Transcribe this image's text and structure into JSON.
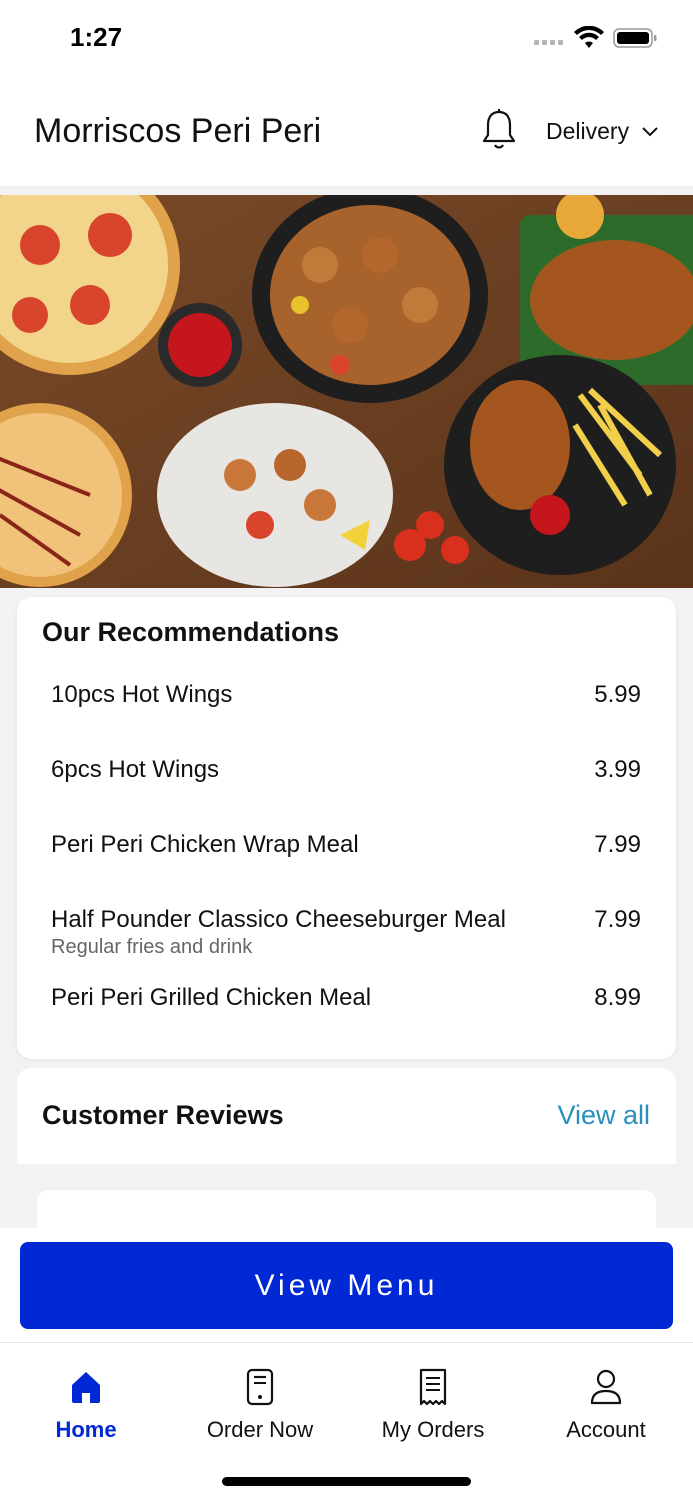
{
  "status_bar": {
    "time": "1:27"
  },
  "header": {
    "title": "Morriscos Peri Peri",
    "order_mode": "Delivery"
  },
  "recommendations": {
    "title": "Our Recommendations",
    "items": [
      {
        "name": "10pcs Hot Wings",
        "description": "",
        "price": "5.99"
      },
      {
        "name": "6pcs Hot Wings",
        "description": "",
        "price": "3.99"
      },
      {
        "name": "Peri Peri Chicken Wrap Meal",
        "description": "",
        "price": "7.99"
      },
      {
        "name": "Half Pounder Classico Cheeseburger Meal",
        "description": "Regular fries and drink",
        "price": "7.99"
      },
      {
        "name": "Peri Peri Grilled Chicken Meal",
        "description": "",
        "price": "8.99"
      }
    ]
  },
  "reviews": {
    "title": "Customer Reviews",
    "view_all": "View all"
  },
  "cta": {
    "label": "View Menu"
  },
  "bottom_nav": {
    "items": [
      {
        "label": "Home",
        "icon": "home-icon",
        "active": true
      },
      {
        "label": "Order Now",
        "icon": "order-icon",
        "active": false
      },
      {
        "label": "My Orders",
        "icon": "receipt-icon",
        "active": false
      },
      {
        "label": "Account",
        "icon": "person-icon",
        "active": false
      }
    ]
  },
  "colors": {
    "accent": "#0028d4",
    "link": "#2a8fbd"
  }
}
